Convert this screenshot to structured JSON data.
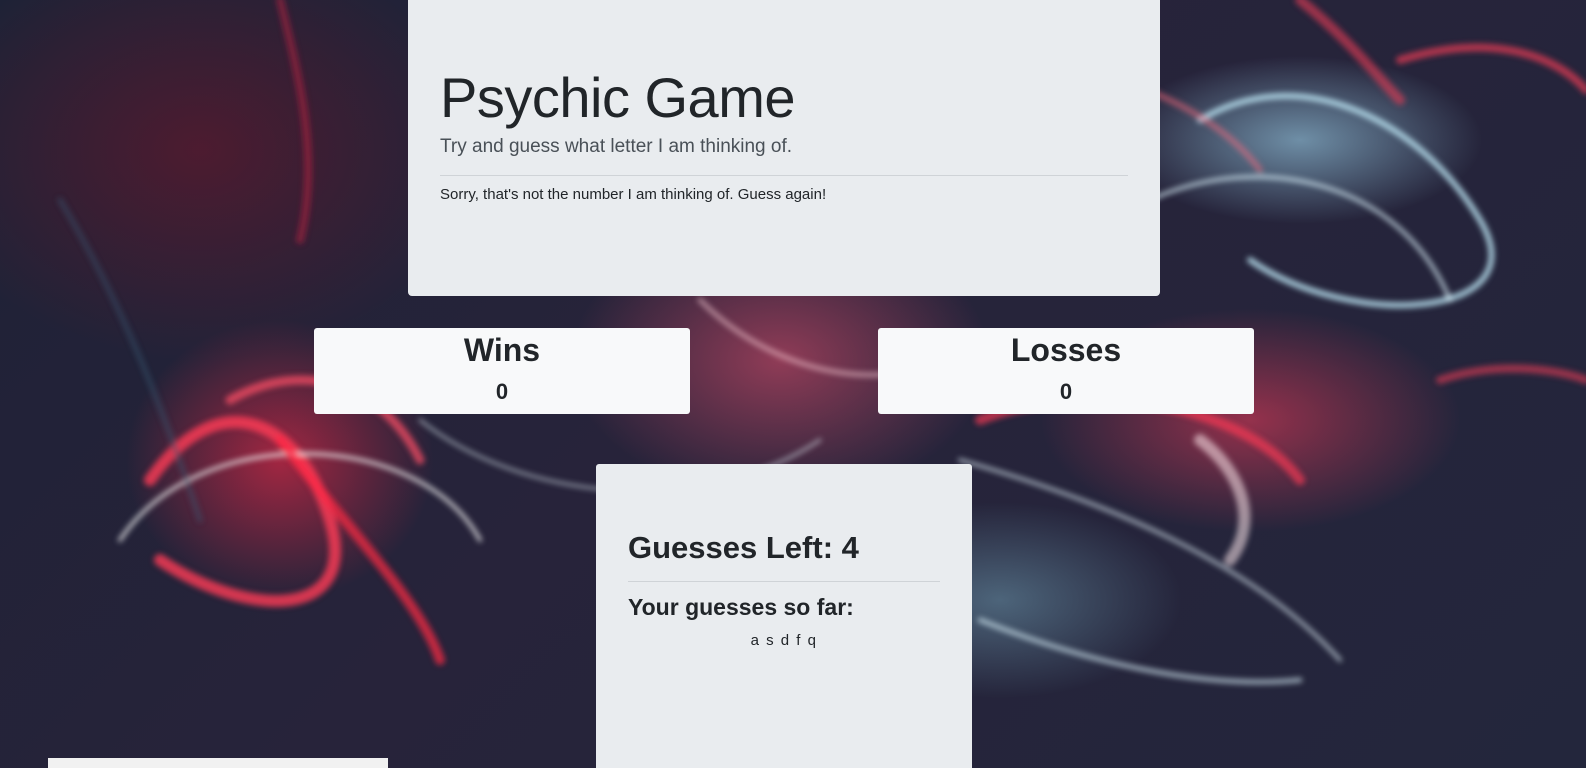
{
  "header": {
    "title": "Psychic Game",
    "subtitle": "Try and guess what letter I am thinking of.",
    "message": "Sorry, that's not the number I am thinking of. Guess again!"
  },
  "scores": {
    "wins_label": "Wins",
    "wins_value": "0",
    "losses_label": "Losses",
    "losses_value": "0"
  },
  "guesses": {
    "left_label": "Guesses Left: ",
    "left_value": "4",
    "so_far_label": "Your guesses so far:",
    "letters": "a s d f q"
  },
  "colors": {
    "panel": "#e9ecef",
    "card": "#f8f9fa",
    "text": "#212529"
  }
}
